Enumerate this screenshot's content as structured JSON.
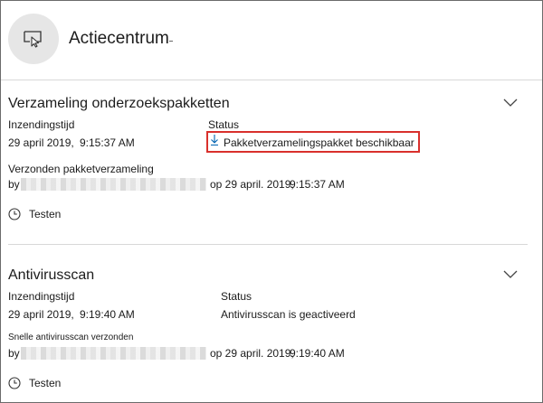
{
  "header": {
    "title": "Actiecentrum",
    "icon": "desktop-cursor-icon"
  },
  "sections": [
    {
      "title": "Verzameling onderzoekspakketten",
      "submission_label": "Inzendingstijd",
      "submission_date": "29 april 2019,",
      "submission_time": "9:15:37 AM",
      "status_label": "Status",
      "status_value": "Pakketverzamelingspakket beschikbaar",
      "status_icon": "download-icon",
      "activity_label": "Verzonden pakketverzameling",
      "by_label": "by",
      "activity_date": "op 29 april. 2019,",
      "activity_time": "9:15:37 AM",
      "action_label": "Testen",
      "action_icon": "clock-icon"
    },
    {
      "title": "Antivirusscan",
      "submission_label": "Inzendingstijd",
      "submission_date": "29 april 2019,",
      "submission_time": "9:19:40 AM",
      "status_label": "Status",
      "status_value": "Antivirusscan is geactiveerd",
      "activity_label": "Snelle antivirusscan verzonden",
      "by_label": "by",
      "activity_date": "op 29 april. 2019,",
      "activity_time": "9:19:40 AM",
      "action_label": "Testen",
      "action_icon": "clock-icon"
    }
  ],
  "colors": {
    "highlight_border": "#d9302c",
    "text": "#1b1b1b",
    "divider": "#d8d8d8",
    "icon_bg": "#e6e6e6"
  }
}
